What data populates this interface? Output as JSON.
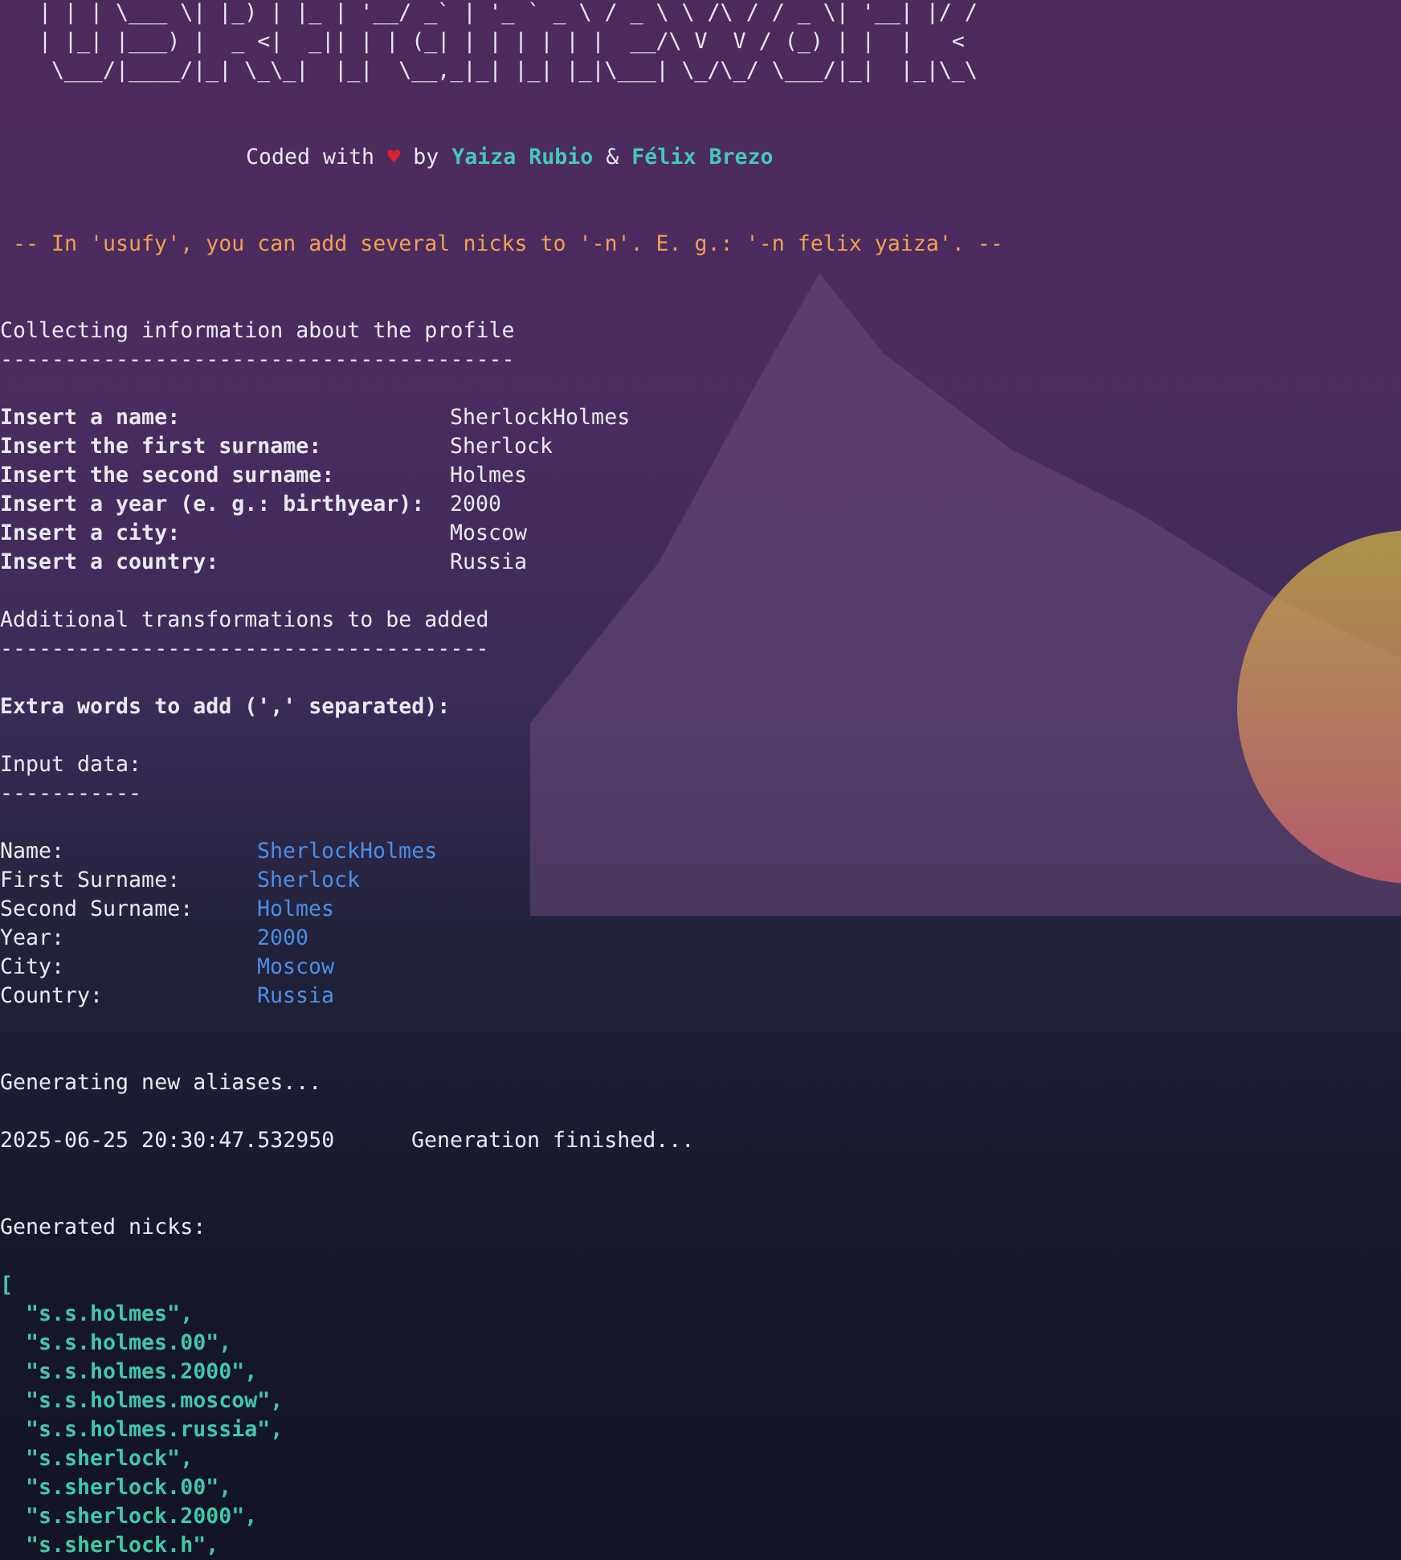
{
  "banner": {
    "art_lines": [
      "   | | | \\___ \\| |_) | |_ | '__/ _` | '_ ` _ \\ / _ \\ \\ /\\ / / _ \\| '__| |/ /",
      "   | |_| |___) |  _ <|  _|| | | (_| | | | | | |  __/\\ V  V / (_) | |  |   <",
      "    \\___/|____/|_| \\_\\_|  |_|  \\__,_|_| |_| |_|\\___| \\_/\\_/ \\___/|_|  |_|\\_\\"
    ],
    "credit": {
      "prefix": "Coded with",
      "heart": "♥",
      "by": "by",
      "author_1": "Yaiza Rubio",
      "ampersand": "&",
      "author_2": "Félix Brezo"
    }
  },
  "tip": "-- In 'usufy', you can add several nicks to '-n'. E. g.: '-n felix yaiza'. --",
  "profile_section": {
    "title": "Collecting information about the profile",
    "rule": "----------------------------------------",
    "fields": [
      {
        "label": "Insert a name:",
        "value": "SherlockHolmes"
      },
      {
        "label": "Insert the first surname:",
        "value": "Sherlock"
      },
      {
        "label": "Insert the second surname:",
        "value": "Holmes"
      },
      {
        "label": "Insert a year (e. g.: birthyear):",
        "value": "2000"
      },
      {
        "label": "Insert a city:",
        "value": "Moscow"
      },
      {
        "label": "Insert a country:",
        "value": "Russia"
      }
    ]
  },
  "transformations": {
    "title": "Additional transformations to be added",
    "rule": "--------------------------------------",
    "extra_words_label": "Extra words to add (',' separated):"
  },
  "input_data": {
    "title": "Input data:",
    "rule": "-----------",
    "fields": [
      {
        "label": "Name:",
        "value": "SherlockHolmes"
      },
      {
        "label": "First Surname:",
        "value": "Sherlock"
      },
      {
        "label": "Second Surname:",
        "value": "Holmes"
      },
      {
        "label": "Year:",
        "value": "2000"
      },
      {
        "label": "City:",
        "value": "Moscow"
      },
      {
        "label": "Country:",
        "value": "Russia"
      }
    ]
  },
  "generating": "Generating new aliases...",
  "log": {
    "timestamp": "2025-06-25 20:30:47.532950",
    "message": "Generation finished..."
  },
  "nicks": {
    "title": "Generated nicks:",
    "open_bracket": "[",
    "items": [
      "\"s.s.holmes\",",
      "\"s.s.holmes.00\",",
      "\"s.s.holmes.2000\",",
      "\"s.s.holmes.moscow\",",
      "\"s.s.holmes.russia\",",
      "\"s.sherlock\",",
      "\"s.sherlock.00\",",
      "\"s.sherlock.2000\",",
      "\"s.sherlock.h\","
    ]
  }
}
